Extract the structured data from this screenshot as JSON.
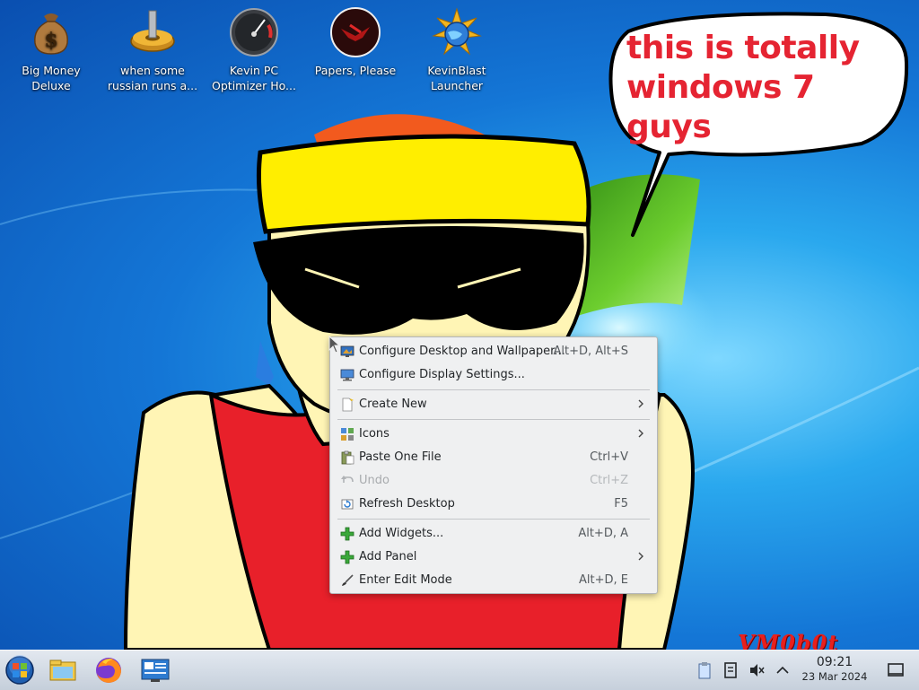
{
  "desktop": {
    "icons": [
      {
        "label": "Big Money\nDeluxe",
        "icon": "money-bag-icon"
      },
      {
        "label": "when some\nrussian runs a...",
        "icon": "gear-icon"
      },
      {
        "label": "Kevin PC\nOptimizer Ho...",
        "icon": "speedometer-icon"
      },
      {
        "label": "Papers, Please",
        "icon": "eagle-emblem-icon"
      },
      {
        "label": "KevinBlast\nLauncher",
        "icon": "globe-star-icon"
      }
    ],
    "speech_line1": "this is totally",
    "speech_line2": "windows 7 guys",
    "watermark": "VM0b0t"
  },
  "context_menu": {
    "items": [
      {
        "label": "Configure Desktop and Wallpaper...",
        "shortcut": "Alt+D, Alt+S",
        "icon": "desktop-wallpaper-icon"
      },
      {
        "label": "Configure Display Settings...",
        "shortcut": "",
        "icon": "display-icon"
      },
      {
        "label": "Create New",
        "submenu": true,
        "icon": "new-document-icon"
      },
      {
        "label": "Icons",
        "submenu": true,
        "icon": "icons-grid-icon"
      },
      {
        "label": "Paste One File",
        "shortcut": "Ctrl+V",
        "icon": "paste-icon"
      },
      {
        "label": "Undo",
        "shortcut": "Ctrl+Z",
        "disabled": true,
        "icon": "undo-icon"
      },
      {
        "label": "Refresh Desktop",
        "shortcut": "F5",
        "icon": "refresh-icon"
      },
      {
        "label": "Add Widgets...",
        "shortcut": "Alt+D, A",
        "icon": "add-icon"
      },
      {
        "label": "Add Panel",
        "submenu": true,
        "icon": "add-icon"
      },
      {
        "label": "Enter Edit Mode",
        "shortcut": "Alt+D, E",
        "icon": "edit-brush-icon"
      }
    ]
  },
  "taskbar": {
    "apps": [
      "start-orb-icon",
      "file-manager-icon",
      "firefox-icon",
      "system-settings-icon"
    ],
    "tray": [
      "clipboard-icon",
      "storage-icon",
      "volume-muted-icon",
      "chevron-up-icon",
      "show-desktop-icon"
    ],
    "time": "09:21",
    "date": "23 Mar 2024"
  },
  "colors": {
    "speech_text": "#e52432",
    "hat": "#ffee00",
    "skin": "#fff5b5",
    "shirt": "#e8202a",
    "menu_bg": "#eff0f1"
  }
}
